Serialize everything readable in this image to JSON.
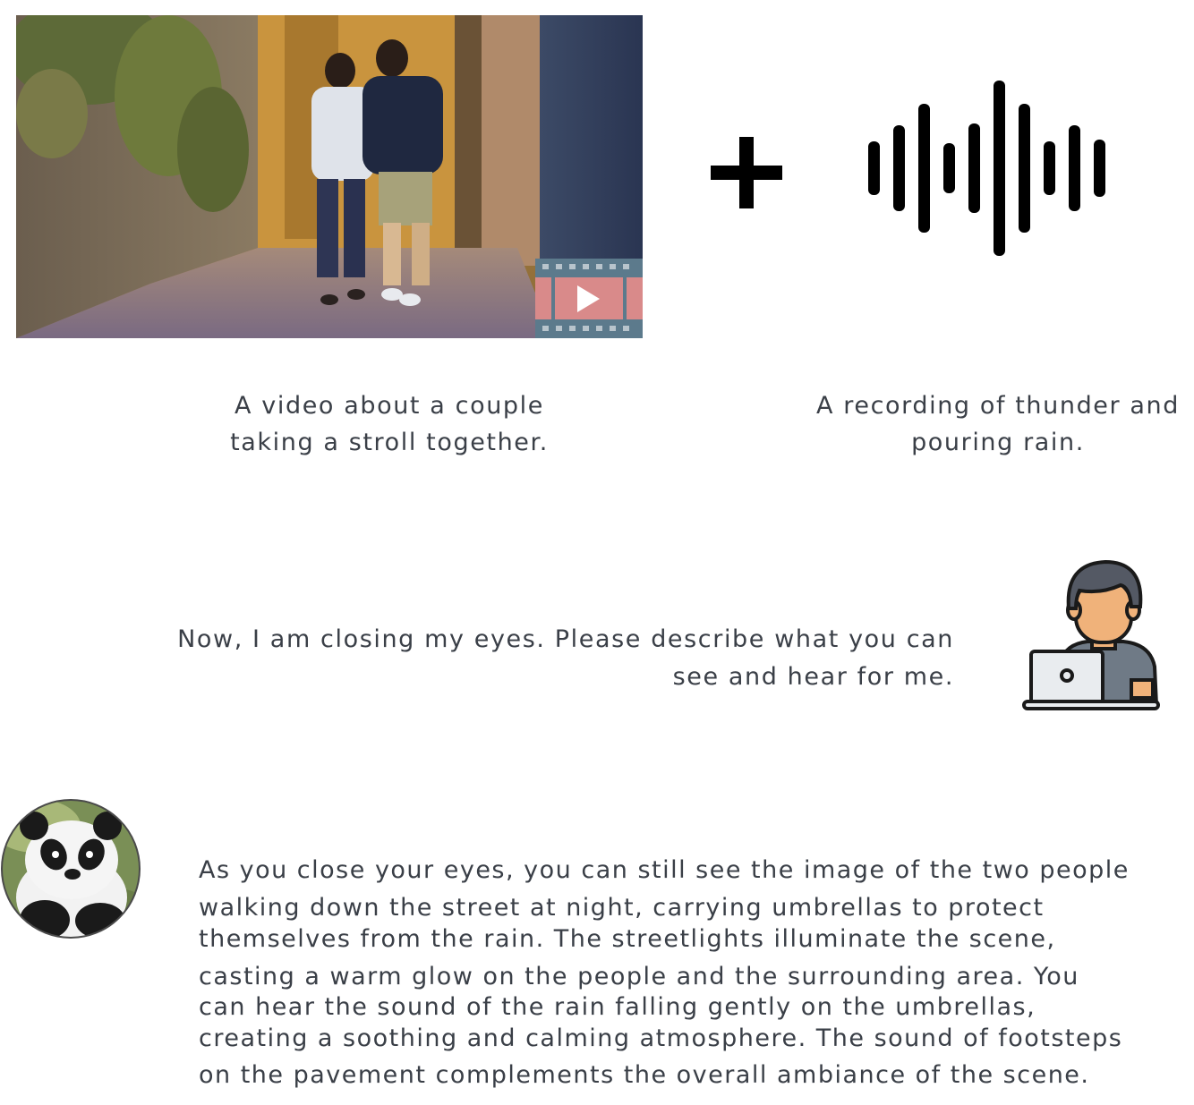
{
  "video": {
    "icon": "film-play-icon",
    "caption_lines": [
      "A video about a couple",
      "taking a stroll together."
    ]
  },
  "plus": {
    "icon": "plus-icon"
  },
  "audio": {
    "icon": "sound-wave-icon",
    "caption_lines": [
      "A recording of thunder and",
      "pouring rain."
    ]
  },
  "user": {
    "icon": "user-laptop-icon",
    "prompt_lines": [
      "Now, I am closing my eyes. Please describe what you can",
      "see and hear for me."
    ]
  },
  "assistant": {
    "icon": "panda-avatar-icon",
    "response_lines": [
      "As you close your eyes, you can still see the image of the two people",
      "walking down the street at night, carrying umbrellas to protect",
      "themselves from the rain. The streetlights illuminate the scene,",
      "casting a warm glow on the people and the surrounding area. You",
      "can hear the sound of the rain falling gently on the umbrellas,",
      "creating a soothing and calming atmosphere. The sound of footsteps",
      "on the pavement complements the overall ambiance of the scene."
    ]
  },
  "colors": {
    "text": "#3a3f47",
    "film_frame": "#5c7a8c",
    "film_panel": "#d98a8a",
    "waveform": "#000000",
    "skin": "#f0b27a"
  }
}
